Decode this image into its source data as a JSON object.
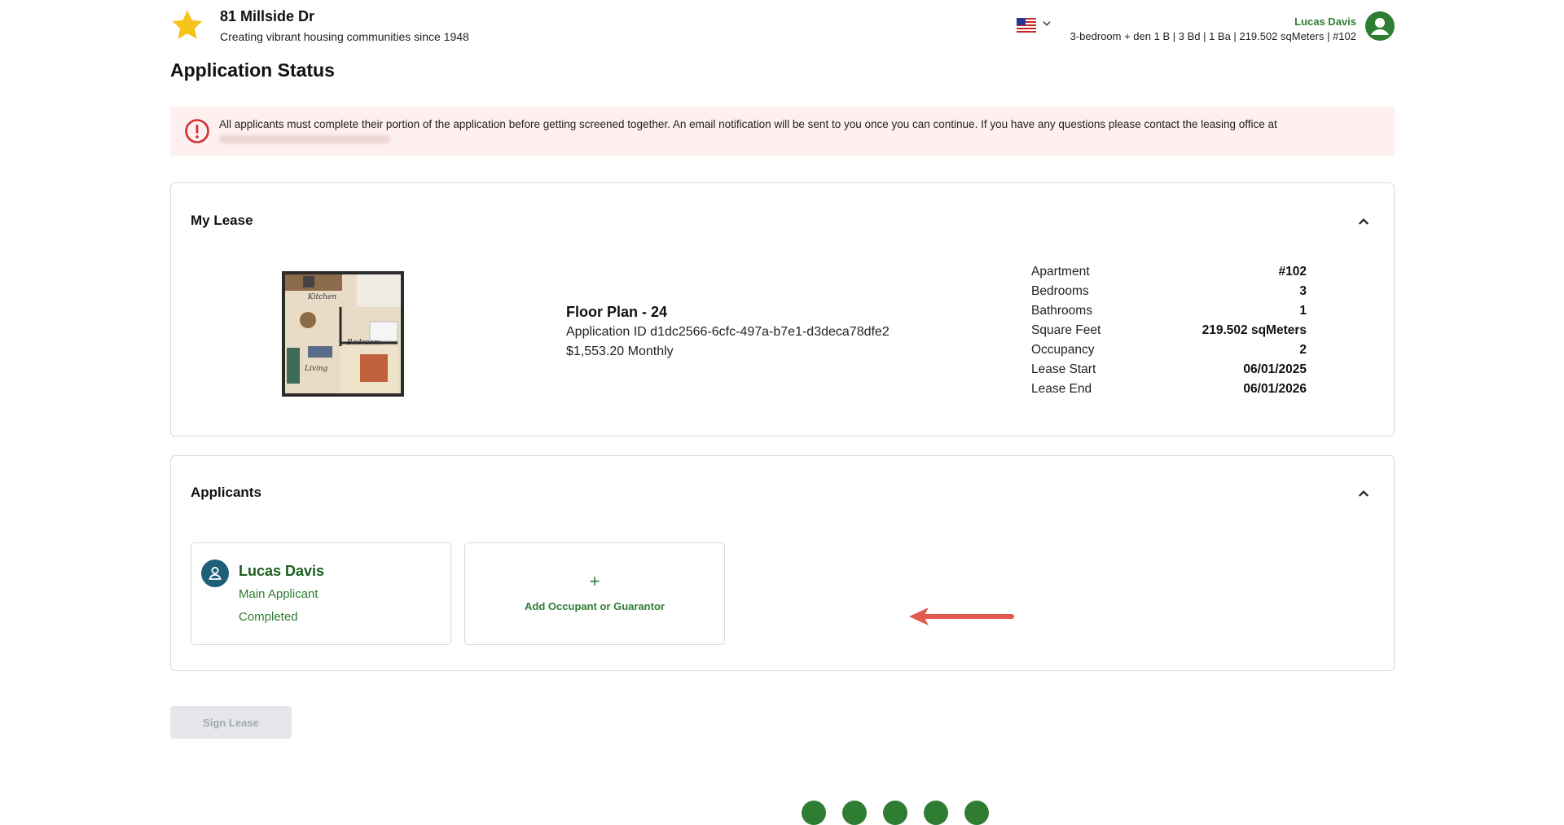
{
  "header": {
    "brand_name": "81 Millside Dr",
    "brand_tagline": "Creating vibrant housing communities since 1948",
    "user_name": "Lucas Davis",
    "unit_summary": "3-bedroom + den 1 B | 3 Bd | 1 Ba | 219.502 sqMeters | #102",
    "icons": {
      "brand": "star-icon",
      "language": "us-flag-icon",
      "language_toggle": "chevron-down-icon",
      "user": "user-avatar-icon"
    }
  },
  "page": {
    "title": "Application Status"
  },
  "alert": {
    "message": "All applicants must complete their portion of the application before getting screened together. An email notification will be sent to you once you can continue. If you have any questions please contact the leasing office at",
    "icon": "alert-circle-icon"
  },
  "lease": {
    "section_title": "My Lease",
    "floor_plan_title": "Floor Plan - 24",
    "application_id": "Application ID d1dc2566-6cfc-497a-b7e1-d3deca78dfe2",
    "rent": "$1,553.20 Monthly",
    "floorplan_labels": {
      "kitchen": "Kitchen",
      "bedroom": "Bedroom",
      "living": "Living"
    },
    "details": [
      {
        "label": "Apartment",
        "value": "#102"
      },
      {
        "label": "Bedrooms",
        "value": "3"
      },
      {
        "label": "Bathrooms",
        "value": "1"
      },
      {
        "label": "Square Feet",
        "value": "219.502 sqMeters"
      },
      {
        "label": "Occupancy",
        "value": "2"
      },
      {
        "label": "Lease Start",
        "value": "06/01/2025"
      },
      {
        "label": "Lease End",
        "value": "06/01/2026"
      }
    ]
  },
  "applicants": {
    "section_title": "Applicants",
    "list": [
      {
        "name": "Lucas Davis",
        "role": "Main Applicant",
        "status": "Completed"
      }
    ],
    "add_plus": "+",
    "add_label": "Add Occupant or Guarantor"
  },
  "actions": {
    "sign_lease": "Sign Lease"
  },
  "colors": {
    "primary_green": "#2e7d32",
    "alert_bg": "#fdf0ef",
    "alert_red": "#d32f2f",
    "avatar_blue": "#1f5f7a",
    "arrow_red": "#e05a4f"
  }
}
